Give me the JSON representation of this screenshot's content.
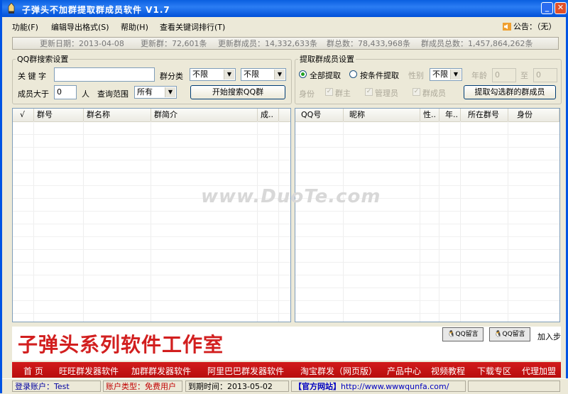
{
  "window": {
    "title": "子弹头不加群提取群成员软件  V1.7"
  },
  "menu": {
    "items": [
      "功能(F)",
      "编辑导出格式(S)",
      "帮助(H)",
      "查看关键词排行(T)"
    ],
    "notice_label": "公告：（无）"
  },
  "stats": {
    "update_date": "更新日期：2013-04-08",
    "new_groups": "更新群：72,601条",
    "new_members": "更新群成员：14,332,633条",
    "total_groups": "群总数：78,433,968条",
    "total_members": "群成员总数：1,457,864,262条"
  },
  "search": {
    "legend": "QQ群搜索设置",
    "keyword_label": "关 键 字",
    "keyword_value": "",
    "category_label": "群分类",
    "category1": "不限",
    "category2": "不限",
    "min_members_label": "成员大于",
    "min_members_value": "0",
    "people_unit": "人",
    "scope_label": "查询范围",
    "scope_value": "所有",
    "search_button": "开始搜索QQ群"
  },
  "extract": {
    "legend": "提取群成员设置",
    "all_label": "全部提取",
    "cond_label": "按条件提取",
    "gender_label": "性别",
    "gender_value": "不限",
    "age_label": "年龄",
    "age_from": "0",
    "to_label": "至",
    "age_to": "0",
    "role_label": "身份",
    "owner_label": "群主",
    "admin_label": "管理员",
    "member_label": "群成员",
    "extract_button": "提取勾选群的群成员"
  },
  "group_table": {
    "columns": [
      "√",
      "群号",
      "群名称",
      "群简介",
      "成.."
    ]
  },
  "member_table": {
    "columns": [
      "QQ号",
      "昵称",
      "性..",
      "年..",
      "所在群号",
      "身份"
    ]
  },
  "banner": {
    "studio": "子弹头系列软件工作室",
    "qq_message": "QQ留言",
    "join": "加入步"
  },
  "nav": {
    "items": [
      "首  页",
      "旺旺群发器软件",
      "加群群发器软件",
      "阿里巴巴群发器软件",
      "淘宝群发（网页版）",
      "产品中心",
      "视频教程",
      "下载专区",
      "代理加盟"
    ]
  },
  "status": {
    "account": "登录账户：Test",
    "account_type": "账户类型：免费用户",
    "expire": "到期时间：2013-05-02",
    "site_label": "【官方网站】",
    "site_url": "http://www.wwwqunfa.com/"
  },
  "watermark": "www.DuoTe.com",
  "colors": {
    "title_bar": "#0054E3",
    "nav_bar": "#C81414",
    "studio_text": "#D21F1F",
    "account_type": "#C00000",
    "site_link": "#0000C0"
  }
}
